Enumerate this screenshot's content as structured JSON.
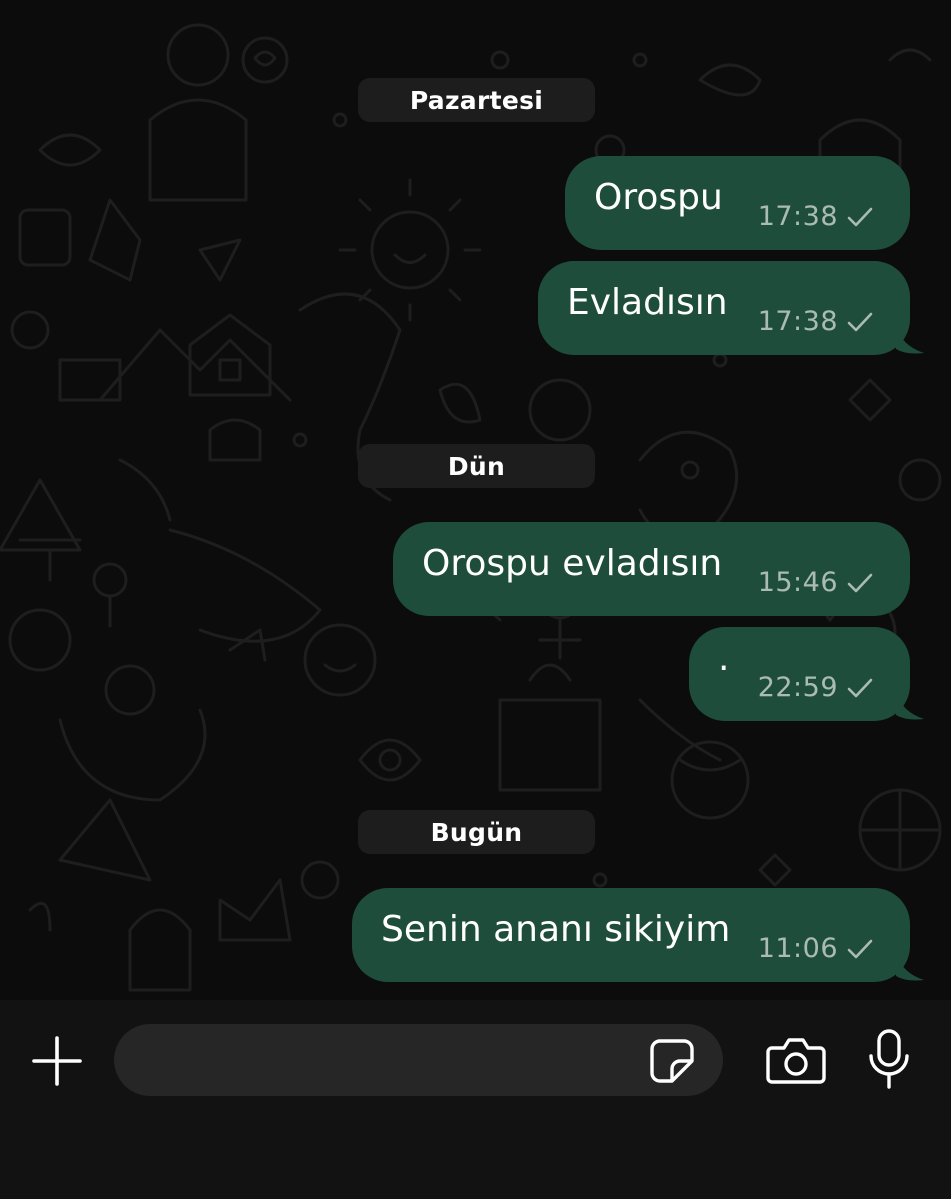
{
  "chat": {
    "days": [
      {
        "label": "Pazartesi",
        "messages": [
          {
            "text": "Orospu",
            "time": "17:38",
            "status": "sent"
          },
          {
            "text": "Evladısın",
            "time": "17:38",
            "status": "sent"
          }
        ]
      },
      {
        "label": "Dün",
        "messages": [
          {
            "text": "Orospu evladısın",
            "time": "15:46",
            "status": "sent"
          },
          {
            "text": "·",
            "time": "22:59",
            "status": "sent"
          }
        ]
      },
      {
        "label": "Bugün",
        "messages": [
          {
            "text": "Senin ananı sikiyim",
            "time": "11:06",
            "status": "sent"
          }
        ]
      }
    ]
  },
  "composer": {
    "value": "",
    "placeholder": "",
    "icons": {
      "attach": "plus-icon",
      "sticker": "sticker-icon",
      "camera": "camera-icon",
      "voice": "microphone-icon"
    }
  },
  "colors": {
    "background": "#0c0c0c",
    "outgoing_bubble": "#1f4d3b",
    "date_pill": "#1d1d1d",
    "input_bar": "#121212",
    "input_field": "#262626"
  }
}
